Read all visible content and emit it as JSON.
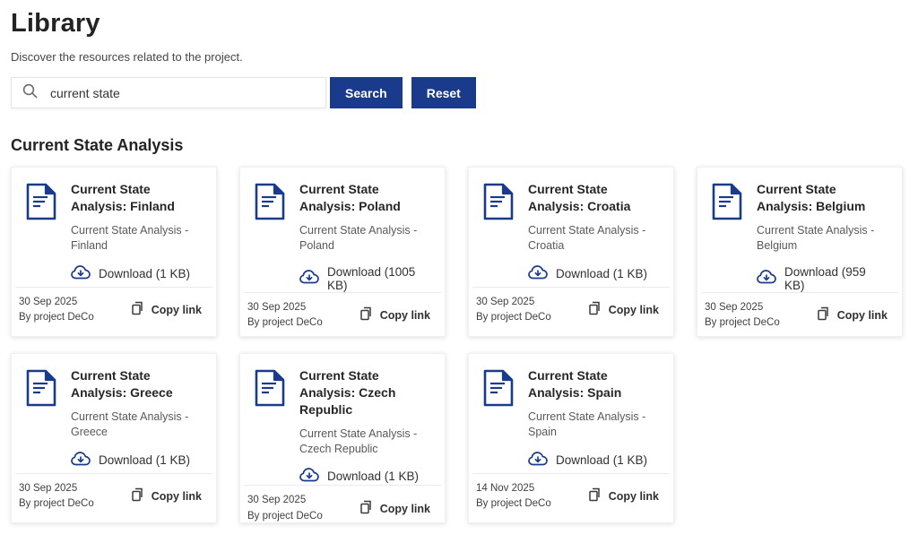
{
  "page": {
    "title": "Library",
    "subtitle": "Discover the resources related to the project."
  },
  "search": {
    "value": "current state",
    "search_button_label": "Search",
    "reset_button_label": "Reset"
  },
  "section": {
    "heading": "Current State Analysis"
  },
  "card_actions": {
    "copy_link_label": "Copy link"
  },
  "cards": [
    {
      "title": "Current State Analysis: Finland",
      "subtitle": "Current State Analysis - Finland",
      "download_label": "Download (1 KB)",
      "date": "30 Sep 2025",
      "author": "By project DeCo",
      "copy_label": "Copy link"
    },
    {
      "title": "Current State Analysis: Poland",
      "subtitle": "Current State Analysis - Poland",
      "download_label": "Download (1005 KB)",
      "date": "30 Sep 2025",
      "author": "By project DeCo",
      "copy_label": "Copy link"
    },
    {
      "title": "Current State Analysis: Croatia",
      "subtitle": "Current State Analysis - Croatia",
      "download_label": "Download (1 KB)",
      "date": "30 Sep 2025",
      "author": "By project DeCo",
      "copy_label": "Copy link"
    },
    {
      "title": "Current State Analysis: Belgium",
      "subtitle": "Current State Analysis - Belgium",
      "download_label": "Download (959 KB)",
      "date": "30 Sep 2025",
      "author": "By project DeCo",
      "copy_label": "Copy link"
    },
    {
      "title": "Current State Analysis: Greece",
      "subtitle": "Current State Analysis - Greece",
      "download_label": "Download (1 KB)",
      "date": "30 Sep 2025",
      "author": "By project DeCo",
      "copy_label": "Copy link"
    },
    {
      "title": "Current State Analysis: Czech Republic",
      "subtitle": "Current State Analysis - Czech Republic",
      "download_label": "Download (1 KB)",
      "date": "30 Sep 2025",
      "author": "By project DeCo",
      "copy_label": "Copy link"
    },
    {
      "title": "Current State Analysis: Spain",
      "subtitle": "Current State Analysis - Spain",
      "download_label": "Download (1 KB)",
      "date": "14 Nov 2025",
      "author": "By project DeCo",
      "copy_label": "Copy link"
    }
  ],
  "icons": {
    "search": "magnifier-icon",
    "document": "document-file-icon",
    "download": "cloud-download-icon",
    "copy": "copy-pages-icon"
  },
  "colors": {
    "primary_blue": "#1a3b8c",
    "title_text": "#232323",
    "muted_text": "#595959",
    "card_border": "#f0f0f0"
  }
}
